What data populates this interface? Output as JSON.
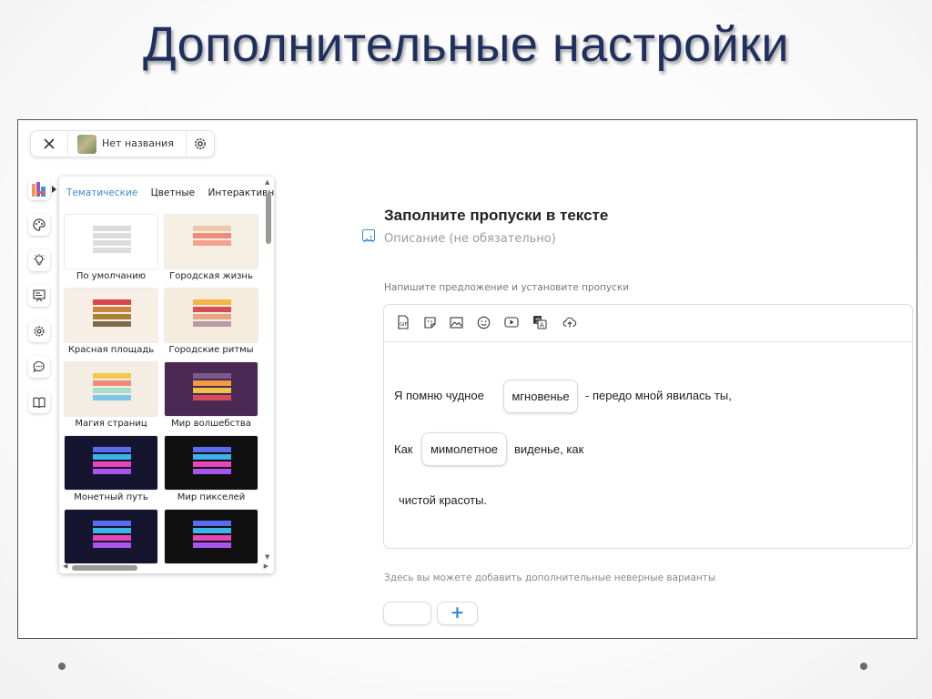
{
  "slide": {
    "title": "Дополнительные настройки"
  },
  "topbar": {
    "close_icon": "close-icon",
    "project_title": "Нет названия",
    "settings_icon": "gear-icon"
  },
  "rail": [
    "themes-icon",
    "palette-icon",
    "lightbulb-icon",
    "task-icon",
    "settings-icon",
    "chat-icon",
    "book-icon"
  ],
  "themes_panel": {
    "tabs": [
      {
        "label": "Тематические",
        "active": true
      },
      {
        "label": "Цветные",
        "active": false
      },
      {
        "label": "Интерактивные",
        "active": false
      }
    ],
    "cards": [
      {
        "label": "По умолчанию",
        "background": "#ffffff",
        "stripes": [
          "#dcdcdc",
          "#dcdcdc",
          "#dcdcdc",
          "#dcdcdc"
        ]
      },
      {
        "label": "Городская жизнь",
        "background": "#f6efe3",
        "stripes": [
          "#e9c9a9",
          "#f08a7a",
          "#f6a28c"
        ]
      },
      {
        "label": "Красная площадь",
        "background": "#f7efe6",
        "stripes": [
          "#d9434a",
          "#c8863a",
          "#a9823a",
          "#7c6a4a"
        ]
      },
      {
        "label": "Городские ритмы",
        "background": "#f5ecde",
        "stripes": [
          "#f4b646",
          "#d64f55",
          "#e6a487",
          "#b79aa6"
        ]
      },
      {
        "label": "Магия страниц",
        "background": "#f3ede4",
        "stripes": [
          "#f2c94c",
          "#f08a7a",
          "#a8e0c8",
          "#7cc6e8"
        ]
      },
      {
        "label": "Мир волшебства",
        "background": "#4a2a55",
        "stripes": [
          "#7a5a8a",
          "#f29a44",
          "#f0c24a",
          "#d84b5c"
        ]
      },
      {
        "label": "Монетный путь",
        "background": "#151530",
        "stripes": [
          "#5a6df0",
          "#3db3e8",
          "#e845b8",
          "#a855f0"
        ]
      },
      {
        "label": "Мир пикселей",
        "background": "#101010",
        "stripes": [
          "#5a6df0",
          "#3db3e8",
          "#e845b8",
          "#a855f0"
        ]
      },
      {
        "label": "",
        "background": "#151530",
        "stripes": [
          "#5a6df0",
          "#3db3e8",
          "#e845b8",
          "#a855f0"
        ]
      },
      {
        "label": "",
        "background": "#101010",
        "stripes": [
          "#5a6df0",
          "#3db3e8",
          "#e845b8",
          "#a855f0"
        ]
      }
    ]
  },
  "task": {
    "title": "Заполните пропуски в тексте",
    "description_placeholder": "Описание (не обязательно)",
    "instruction": "Напишите предложение и установите пропуски",
    "toolbar_icons": [
      "gif-icon",
      "sticker-icon",
      "image-icon",
      "emoji-icon",
      "video-icon",
      "translate-icon",
      "upload-icon"
    ],
    "line1_before": "Я помню чудное",
    "gap1": "мгновенье",
    "line1_after": "- передо мной явилась ты,",
    "line2_before": "Как",
    "gap2": "мимолетное",
    "line2_after": "виденье, как",
    "line3": "чистой красоты.",
    "extra_hint": "Здесь вы можете добавить дополнительные неверные варианты",
    "add_label": "+"
  }
}
